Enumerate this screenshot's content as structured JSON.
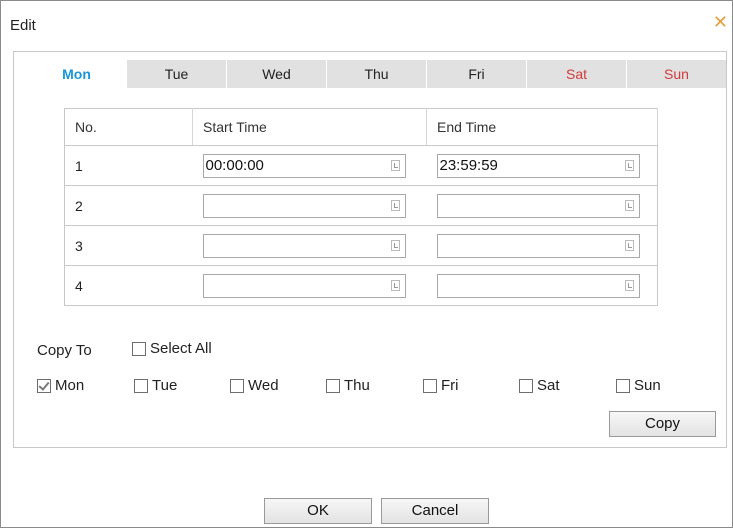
{
  "dialog": {
    "title": "Edit",
    "close_glyph": "✕"
  },
  "tabs": [
    {
      "label": "Mon",
      "active": true
    },
    {
      "label": "Tue"
    },
    {
      "label": "Wed"
    },
    {
      "label": "Thu"
    },
    {
      "label": "Fri"
    },
    {
      "label": "Sat",
      "weekend": true
    },
    {
      "label": "Sun",
      "weekend": true
    }
  ],
  "table": {
    "headers": {
      "no": "No.",
      "start": "Start Time",
      "end": "End Time"
    },
    "rows": [
      {
        "no": "1",
        "start": "00:00:00",
        "end": "23:59:59"
      },
      {
        "no": "2",
        "start": "",
        "end": ""
      },
      {
        "no": "3",
        "start": "",
        "end": ""
      },
      {
        "no": "4",
        "start": "",
        "end": ""
      }
    ]
  },
  "copy": {
    "label": "Copy To",
    "select_all": "Select All",
    "days": {
      "mon": "Mon",
      "tue": "Tue",
      "wed": "Wed",
      "thu": "Thu",
      "fri": "Fri",
      "sat": "Sat",
      "sun": "Sun"
    },
    "button": "Copy"
  },
  "footer": {
    "ok": "OK",
    "cancel": "Cancel"
  },
  "colors": {
    "active_tab": "#1b96d6",
    "weekend_tab": "#d23b3b",
    "close_icon": "#e3a03b"
  }
}
